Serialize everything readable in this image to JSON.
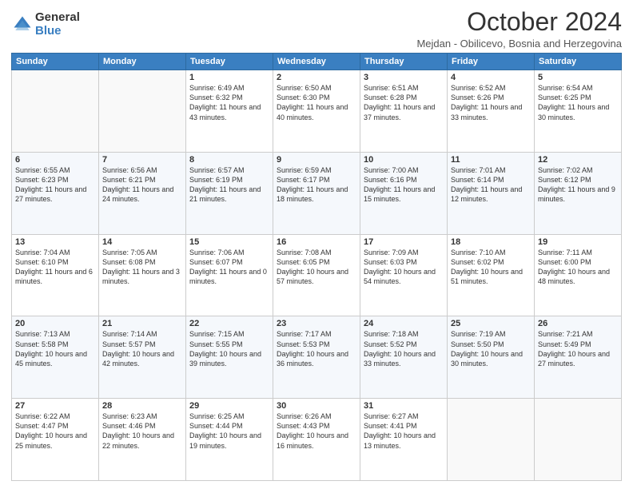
{
  "logo": {
    "general": "General",
    "blue": "Blue"
  },
  "header": {
    "month": "October 2024",
    "subtitle": "Mejdan - Obilicevo, Bosnia and Herzegovina"
  },
  "weekdays": [
    "Sunday",
    "Monday",
    "Tuesday",
    "Wednesday",
    "Thursday",
    "Friday",
    "Saturday"
  ],
  "weeks": [
    [
      {
        "day": "",
        "sunrise": "",
        "sunset": "",
        "daylight": ""
      },
      {
        "day": "",
        "sunrise": "",
        "sunset": "",
        "daylight": ""
      },
      {
        "day": "1",
        "sunrise": "Sunrise: 6:49 AM",
        "sunset": "Sunset: 6:32 PM",
        "daylight": "Daylight: 11 hours and 43 minutes."
      },
      {
        "day": "2",
        "sunrise": "Sunrise: 6:50 AM",
        "sunset": "Sunset: 6:30 PM",
        "daylight": "Daylight: 11 hours and 40 minutes."
      },
      {
        "day": "3",
        "sunrise": "Sunrise: 6:51 AM",
        "sunset": "Sunset: 6:28 PM",
        "daylight": "Daylight: 11 hours and 37 minutes."
      },
      {
        "day": "4",
        "sunrise": "Sunrise: 6:52 AM",
        "sunset": "Sunset: 6:26 PM",
        "daylight": "Daylight: 11 hours and 33 minutes."
      },
      {
        "day": "5",
        "sunrise": "Sunrise: 6:54 AM",
        "sunset": "Sunset: 6:25 PM",
        "daylight": "Daylight: 11 hours and 30 minutes."
      }
    ],
    [
      {
        "day": "6",
        "sunrise": "Sunrise: 6:55 AM",
        "sunset": "Sunset: 6:23 PM",
        "daylight": "Daylight: 11 hours and 27 minutes."
      },
      {
        "day": "7",
        "sunrise": "Sunrise: 6:56 AM",
        "sunset": "Sunset: 6:21 PM",
        "daylight": "Daylight: 11 hours and 24 minutes."
      },
      {
        "day": "8",
        "sunrise": "Sunrise: 6:57 AM",
        "sunset": "Sunset: 6:19 PM",
        "daylight": "Daylight: 11 hours and 21 minutes."
      },
      {
        "day": "9",
        "sunrise": "Sunrise: 6:59 AM",
        "sunset": "Sunset: 6:17 PM",
        "daylight": "Daylight: 11 hours and 18 minutes."
      },
      {
        "day": "10",
        "sunrise": "Sunrise: 7:00 AM",
        "sunset": "Sunset: 6:16 PM",
        "daylight": "Daylight: 11 hours and 15 minutes."
      },
      {
        "day": "11",
        "sunrise": "Sunrise: 7:01 AM",
        "sunset": "Sunset: 6:14 PM",
        "daylight": "Daylight: 11 hours and 12 minutes."
      },
      {
        "day": "12",
        "sunrise": "Sunrise: 7:02 AM",
        "sunset": "Sunset: 6:12 PM",
        "daylight": "Daylight: 11 hours and 9 minutes."
      }
    ],
    [
      {
        "day": "13",
        "sunrise": "Sunrise: 7:04 AM",
        "sunset": "Sunset: 6:10 PM",
        "daylight": "Daylight: 11 hours and 6 minutes."
      },
      {
        "day": "14",
        "sunrise": "Sunrise: 7:05 AM",
        "sunset": "Sunset: 6:08 PM",
        "daylight": "Daylight: 11 hours and 3 minutes."
      },
      {
        "day": "15",
        "sunrise": "Sunrise: 7:06 AM",
        "sunset": "Sunset: 6:07 PM",
        "daylight": "Daylight: 11 hours and 0 minutes."
      },
      {
        "day": "16",
        "sunrise": "Sunrise: 7:08 AM",
        "sunset": "Sunset: 6:05 PM",
        "daylight": "Daylight: 10 hours and 57 minutes."
      },
      {
        "day": "17",
        "sunrise": "Sunrise: 7:09 AM",
        "sunset": "Sunset: 6:03 PM",
        "daylight": "Daylight: 10 hours and 54 minutes."
      },
      {
        "day": "18",
        "sunrise": "Sunrise: 7:10 AM",
        "sunset": "Sunset: 6:02 PM",
        "daylight": "Daylight: 10 hours and 51 minutes."
      },
      {
        "day": "19",
        "sunrise": "Sunrise: 7:11 AM",
        "sunset": "Sunset: 6:00 PM",
        "daylight": "Daylight: 10 hours and 48 minutes."
      }
    ],
    [
      {
        "day": "20",
        "sunrise": "Sunrise: 7:13 AM",
        "sunset": "Sunset: 5:58 PM",
        "daylight": "Daylight: 10 hours and 45 minutes."
      },
      {
        "day": "21",
        "sunrise": "Sunrise: 7:14 AM",
        "sunset": "Sunset: 5:57 PM",
        "daylight": "Daylight: 10 hours and 42 minutes."
      },
      {
        "day": "22",
        "sunrise": "Sunrise: 7:15 AM",
        "sunset": "Sunset: 5:55 PM",
        "daylight": "Daylight: 10 hours and 39 minutes."
      },
      {
        "day": "23",
        "sunrise": "Sunrise: 7:17 AM",
        "sunset": "Sunset: 5:53 PM",
        "daylight": "Daylight: 10 hours and 36 minutes."
      },
      {
        "day": "24",
        "sunrise": "Sunrise: 7:18 AM",
        "sunset": "Sunset: 5:52 PM",
        "daylight": "Daylight: 10 hours and 33 minutes."
      },
      {
        "day": "25",
        "sunrise": "Sunrise: 7:19 AM",
        "sunset": "Sunset: 5:50 PM",
        "daylight": "Daylight: 10 hours and 30 minutes."
      },
      {
        "day": "26",
        "sunrise": "Sunrise: 7:21 AM",
        "sunset": "Sunset: 5:49 PM",
        "daylight": "Daylight: 10 hours and 27 minutes."
      }
    ],
    [
      {
        "day": "27",
        "sunrise": "Sunrise: 6:22 AM",
        "sunset": "Sunset: 4:47 PM",
        "daylight": "Daylight: 10 hours and 25 minutes."
      },
      {
        "day": "28",
        "sunrise": "Sunrise: 6:23 AM",
        "sunset": "Sunset: 4:46 PM",
        "daylight": "Daylight: 10 hours and 22 minutes."
      },
      {
        "day": "29",
        "sunrise": "Sunrise: 6:25 AM",
        "sunset": "Sunset: 4:44 PM",
        "daylight": "Daylight: 10 hours and 19 minutes."
      },
      {
        "day": "30",
        "sunrise": "Sunrise: 6:26 AM",
        "sunset": "Sunset: 4:43 PM",
        "daylight": "Daylight: 10 hours and 16 minutes."
      },
      {
        "day": "31",
        "sunrise": "Sunrise: 6:27 AM",
        "sunset": "Sunset: 4:41 PM",
        "daylight": "Daylight: 10 hours and 13 minutes."
      },
      {
        "day": "",
        "sunrise": "",
        "sunset": "",
        "daylight": ""
      },
      {
        "day": "",
        "sunrise": "",
        "sunset": "",
        "daylight": ""
      }
    ]
  ]
}
